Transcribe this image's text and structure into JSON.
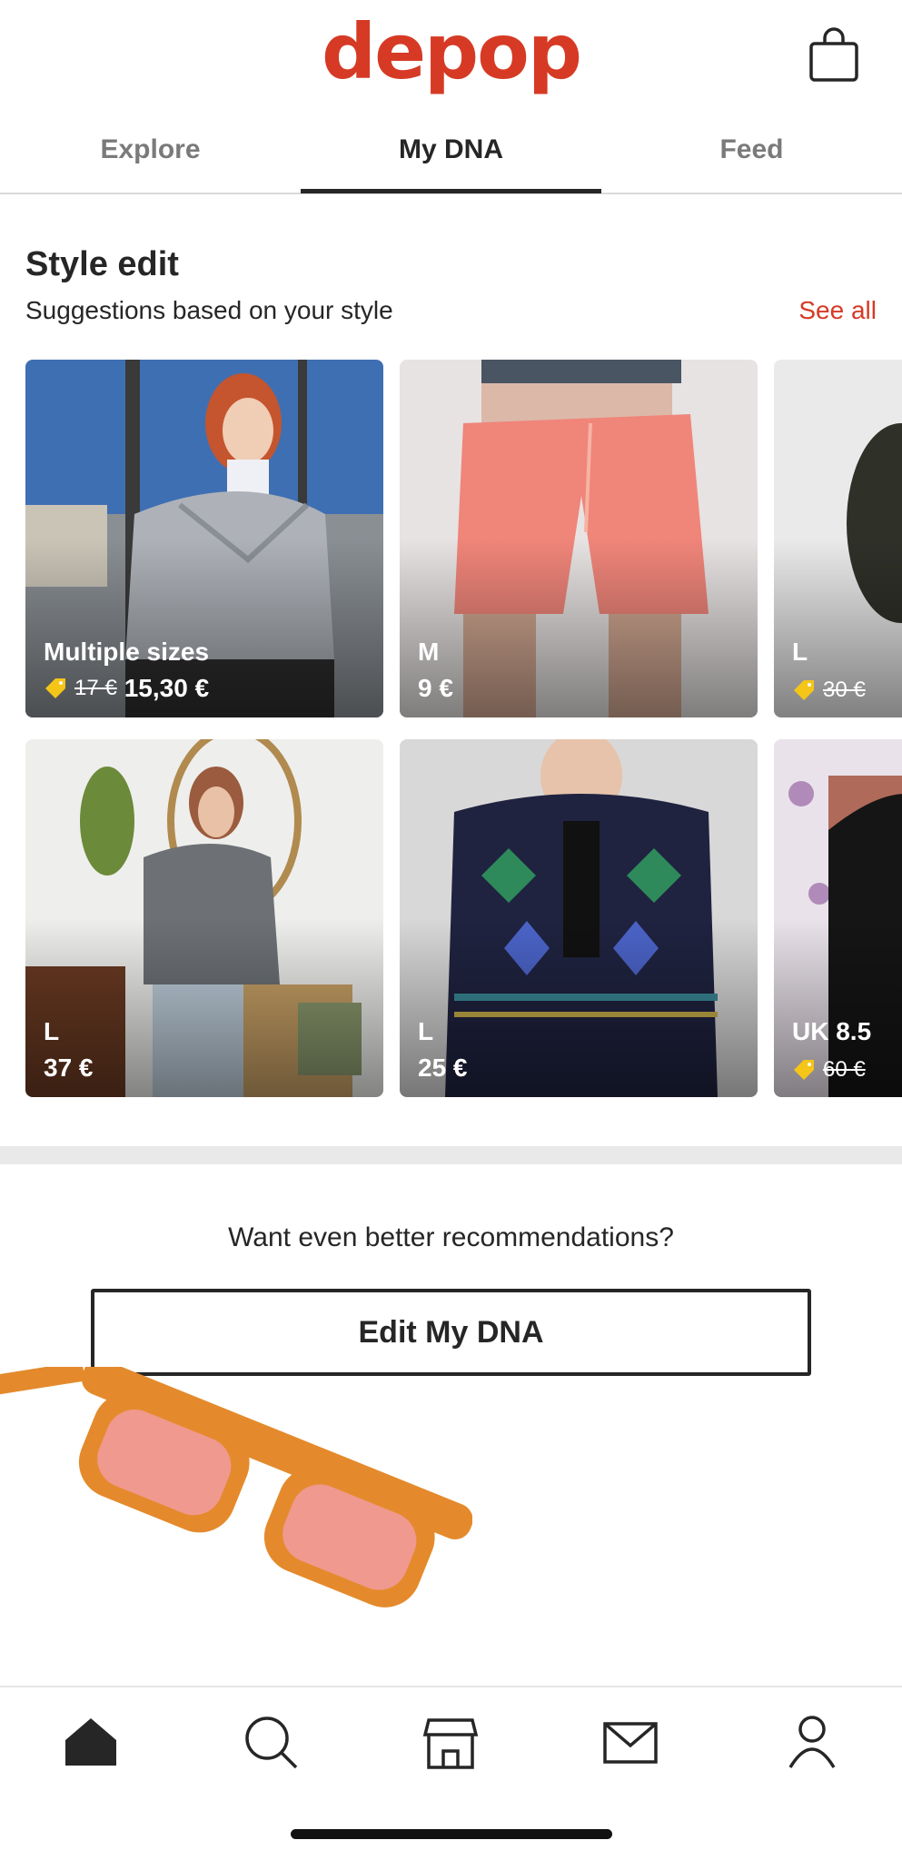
{
  "header": {
    "logo": "depop",
    "bag_icon": "shopping-bag-icon"
  },
  "tabs": [
    {
      "label": "Explore",
      "active": false
    },
    {
      "label": "My DNA",
      "active": true
    },
    {
      "label": "Feed",
      "active": false
    }
  ],
  "style_edit": {
    "title": "Style edit",
    "subtitle": "Suggestions based on your style",
    "see_all": "See all"
  },
  "products": [
    {
      "size": "Multiple sizes",
      "old_price": "17 €",
      "price": "15,30 €",
      "on_sale": true
    },
    {
      "size": "M",
      "price": "9 €",
      "on_sale": false
    },
    {
      "size": "L",
      "old_price": "30 €",
      "price": "",
      "on_sale": true
    },
    {
      "size": "L",
      "price": "37 €",
      "on_sale": false
    },
    {
      "size": "L",
      "price": "25 €",
      "on_sale": false
    },
    {
      "size": "UK 8.5",
      "old_price": "60 €",
      "price": "",
      "on_sale": true
    }
  ],
  "recommendations": {
    "prompt": "Want even better recommendations?",
    "button": "Edit My DNA"
  },
  "bottom_nav": [
    "home-icon",
    "search-icon",
    "shop-icon",
    "inbox-icon",
    "profile-icon"
  ],
  "colors": {
    "brand": "#d63a25",
    "text": "#262626",
    "sale_tag": "#f5c518"
  }
}
